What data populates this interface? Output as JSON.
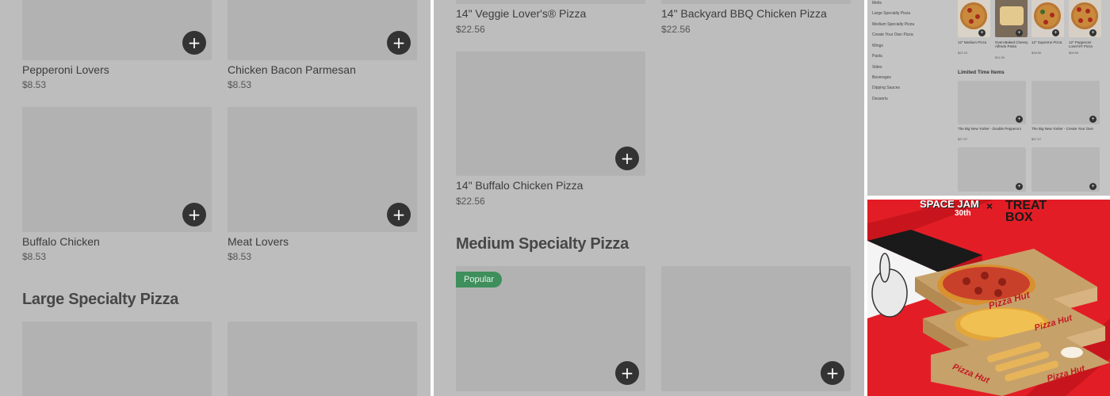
{
  "panel_left": {
    "items": [
      {
        "name": "Pepperoni Lovers",
        "price": "$8.53"
      },
      {
        "name": "Chicken Bacon Parmesan",
        "price": "$8.53"
      },
      {
        "name": "Buffalo Chicken",
        "price": "$8.53"
      },
      {
        "name": "Meat Lovers",
        "price": "$8.53"
      }
    ],
    "section_title": "Large Specialty Pizza",
    "add_glyph": "+"
  },
  "panel_middle": {
    "items": [
      {
        "name": "14\" Veggie Lover's® Pizza",
        "price": "$22.56"
      },
      {
        "name": "14\" Backyard BBQ Chicken Pizza",
        "price": "$22.56"
      },
      {
        "name": "14\" Buffalo Chicken Pizza",
        "price": "$22.56"
      }
    ],
    "section_title": "Medium Specialty Pizza",
    "badge": "Popular"
  },
  "mini_menu": {
    "sidebar": [
      "Melts",
      "Large Specialty Pizza",
      "Medium Specialty Pizza",
      "Create Your Own Pizza",
      "Wings",
      "Pasta",
      "Sides",
      "Beverages",
      "Dipping Sauces",
      "Desserts"
    ],
    "products": [
      {
        "name": "12\" Medium Pizza",
        "price": "$22.24"
      },
      {
        "name": "Oven-Baked Cheesy Alfredo Pasta",
        "price": "$11.59"
      },
      {
        "name": "12\" Supreme Pizza",
        "price": "$28.90"
      },
      {
        "name": "12\" Pepperoni Lover's® Pizza",
        "price": "$28.90"
      }
    ],
    "limited_title": "Limited Time Items",
    "limited": [
      {
        "name": "The Big New Yorker - Double Pepperoni",
        "price": "$27.07"
      },
      {
        "name": "The Big New Yorker - Create Your Own",
        "price": "$27.07"
      }
    ]
  },
  "ad": {
    "left_text": "SPACE JAM",
    "left_sub": "30th",
    "separator": "×",
    "right_text": "TREAT BOX",
    "brand": "Pizza Hut",
    "colors": {
      "background": "#e31d26",
      "box": "#c7a16a"
    }
  }
}
